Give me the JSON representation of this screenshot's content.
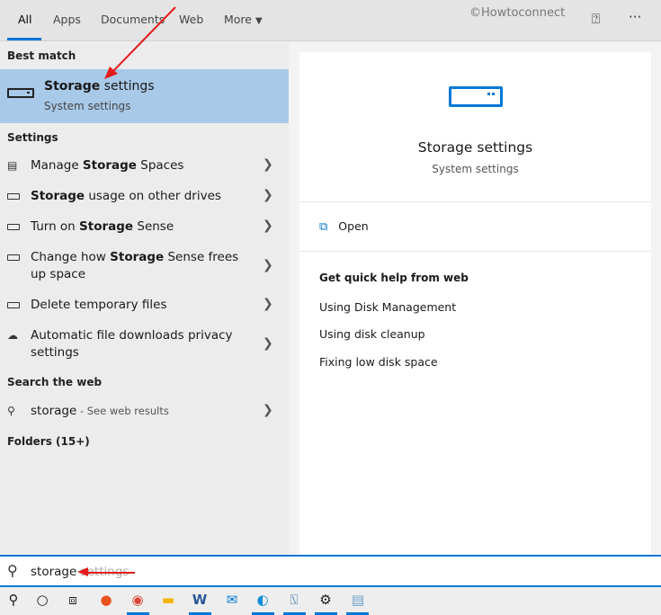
{
  "tabs": [
    "All",
    "Apps",
    "Documents",
    "Web",
    "More"
  ],
  "watermark": "©Howtoconnect",
  "best_match": {
    "header": "Best match",
    "title_bold": "Storage",
    "title_rest": " settings",
    "subtitle": "System settings"
  },
  "settings_header": "Settings",
  "settings_items": [
    {
      "pre": "Manage ",
      "bold": "Storage",
      "post": " Spaces",
      "icon": "storage-spaces-icon"
    },
    {
      "pre": "",
      "bold": "Storage",
      "post": " usage on other drives",
      "icon": "drive-icon"
    },
    {
      "pre": "Turn on ",
      "bold": "Storage",
      "post": " Sense",
      "icon": "drive-icon"
    },
    {
      "pre": "Change how ",
      "bold": "Storage",
      "post": " Sense frees up space",
      "icon": "drive-icon"
    },
    {
      "pre": "Delete temporary files",
      "bold": "",
      "post": "",
      "icon": "drive-icon"
    },
    {
      "pre": "Automatic file downloads privacy settings",
      "bold": "",
      "post": "",
      "icon": "cloud-icon"
    }
  ],
  "web_header": "Search the web",
  "web_item": {
    "query": "storage",
    "suffix": " - See web results"
  },
  "folders_header": "Folders (15+)",
  "preview": {
    "title": "Storage settings",
    "subtitle": "System settings",
    "open": "Open",
    "help_header": "Get quick help from web",
    "links": [
      "Using Disk Management",
      "Using disk cleanup",
      "Fixing low disk space"
    ]
  },
  "search": {
    "typed": "storage",
    "suggestion": " settings"
  },
  "taskbar": [
    "search",
    "cortana",
    "task-view",
    "firefox",
    "chrome",
    "file-explorer",
    "word",
    "mail",
    "edge",
    "performance-monitor",
    "settings",
    "notepad"
  ],
  "accent": "#0078d7"
}
